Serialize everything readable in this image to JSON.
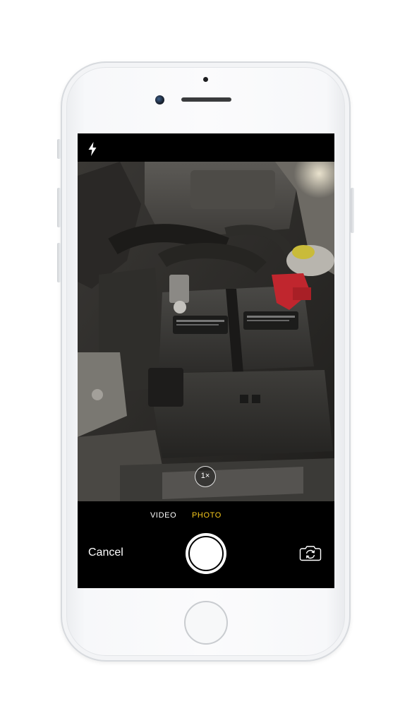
{
  "camera": {
    "flash_icon": "lightning-bolt",
    "zoom_label": "1×",
    "modes": {
      "video": "VIDEO",
      "photo": "PHOTO"
    },
    "active_mode": "photo",
    "cancel_label": "Cancel",
    "switch_camera_icon": "camera-rotate",
    "colors": {
      "active_mode": "#f6c81c",
      "background": "#000000"
    }
  }
}
